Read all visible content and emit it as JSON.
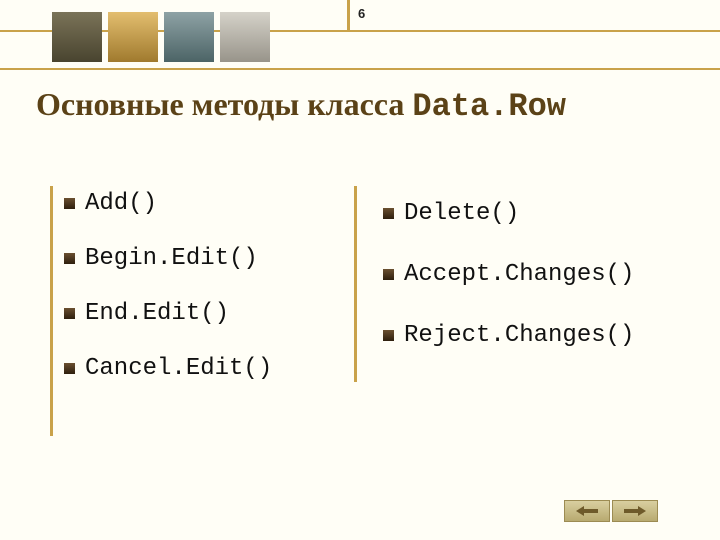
{
  "page_number": "6",
  "title_prefix": "Основные методы класса ",
  "title_code": "Data.Row",
  "left_methods": [
    "Add()",
    "Begin.Edit()",
    "End.Edit()",
    "Cancel.Edit()"
  ],
  "right_methods": [
    "Delete()",
    "Accept.Changes()",
    "Reject.Changes()"
  ]
}
